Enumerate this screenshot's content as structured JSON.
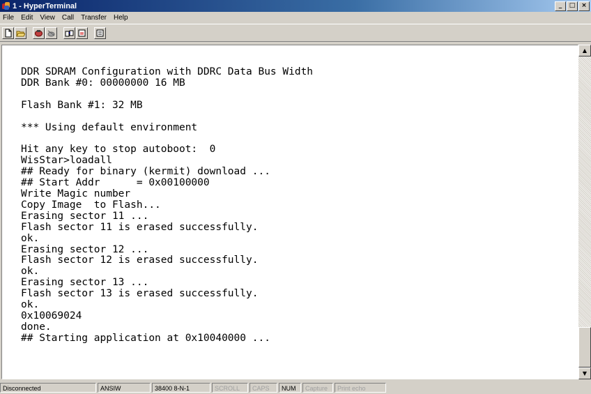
{
  "window": {
    "title": "1 - HyperTerminal",
    "controls": {
      "minimize": "_",
      "maximize": "□",
      "close": "×"
    }
  },
  "menu": [
    "File",
    "Edit",
    "View",
    "Call",
    "Transfer",
    "Help"
  ],
  "toolbar": {
    "icons": [
      "new-document-icon",
      "open-folder-icon",
      "phone-connect-icon",
      "disconnect-icon",
      "send-file-icon",
      "receive-file-icon",
      "properties-icon"
    ]
  },
  "terminal": {
    "lines": [
      "DDR SDRAM Configuration with DDRC Data Bus Width",
      "DDR Bank #0: 00000000 16 MB",
      "",
      "Flash Bank #1: 32 MB",
      "",
      "*** Using default environment",
      "",
      "Hit any key to stop autoboot:  0",
      "WisStar>loadall",
      "## Ready for binary (kermit) download ...",
      "## Start Addr      = 0x00100000",
      "Write Magic number",
      "Copy Image  to Flash...",
      "Erasing sector 11 ...",
      "Flash sector 11 is erased successfully.",
      "ok.",
      "Erasing sector 12 ...",
      "Flash sector 12 is erased successfully.",
      "ok.",
      "Erasing sector 13 ...",
      "Flash sector 13 is erased successfully.",
      "ok.",
      "0x10069024",
      "done.",
      "## Starting application at 0x10040000 ..."
    ]
  },
  "scrollbar": {
    "up": "▲",
    "down": "▼"
  },
  "status": {
    "connection": "Disconnected",
    "emulation": "ANSIW",
    "settings": "38400 8-N-1",
    "scroll": "SCROLL",
    "caps": "CAPS",
    "num": "NUM",
    "capture": "Capture",
    "print_echo": "Print echo"
  }
}
